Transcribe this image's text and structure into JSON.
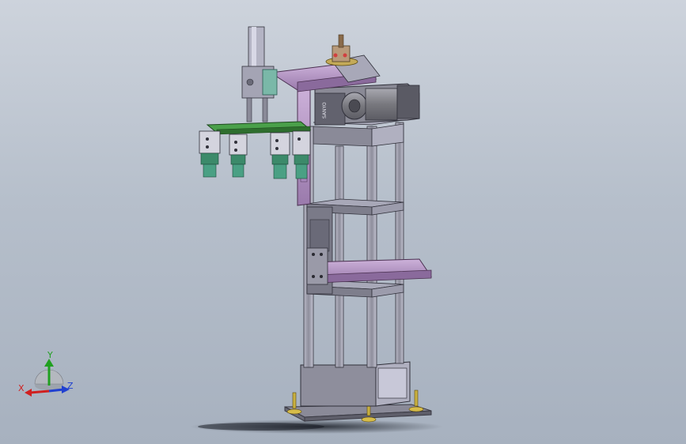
{
  "triad": {
    "x_label": "X",
    "y_label": "Y",
    "z_label": "Z",
    "x_color": "#d02020",
    "y_color": "#20a020",
    "z_color": "#2040d0"
  },
  "model": {
    "motor_label": "SANYO",
    "colors": {
      "frame": "#9a9aa8",
      "frame_dark": "#6e6e7c",
      "arm_purple": "#b89ac8",
      "arm_purple_dark": "#8a6a9c",
      "gripper_plate": "#3c8a3c",
      "gripper_teal": "#3f9a8a",
      "base_shadow": "#1a1e26"
    }
  }
}
